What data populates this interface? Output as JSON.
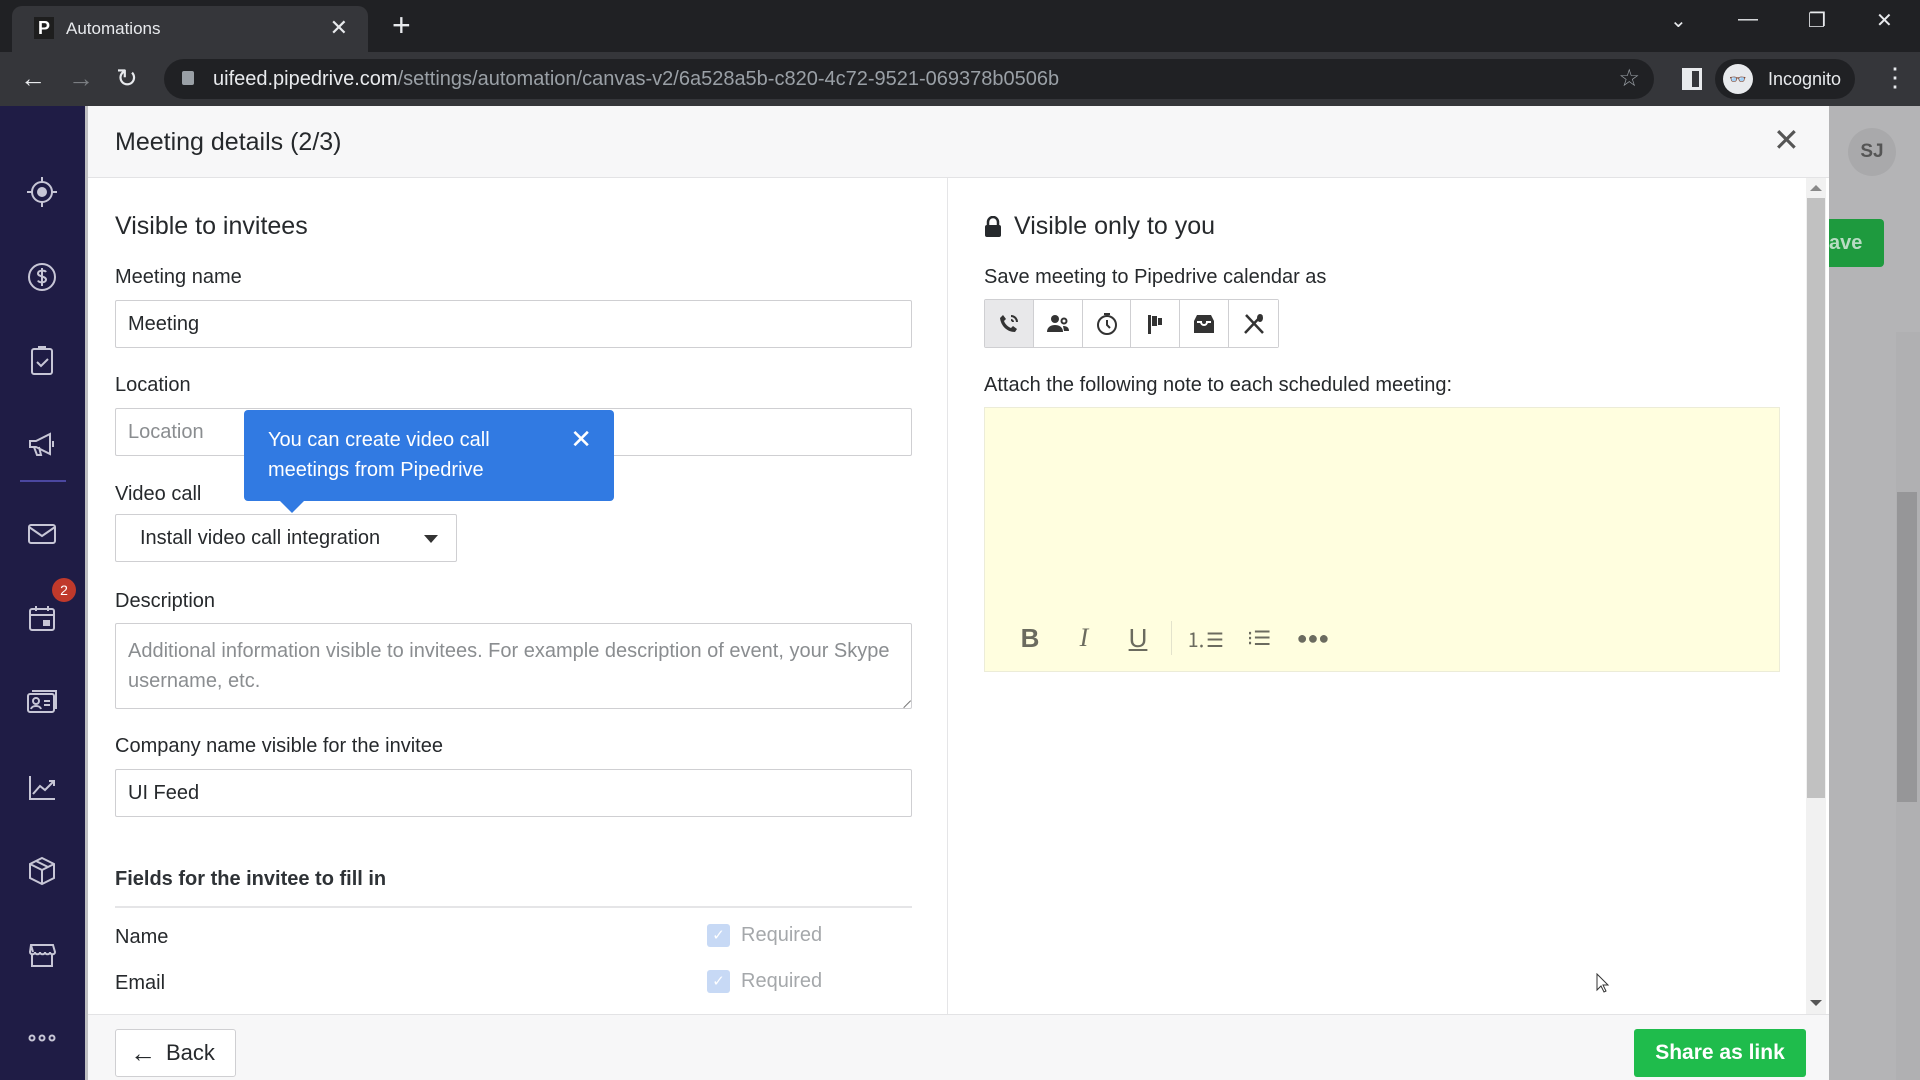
{
  "browser": {
    "tab_title": "Automations",
    "favicon_letter": "P",
    "url_domain": "uifeed.pipedrive.com",
    "url_path": "/settings/automation/canvas-v2/6a528a5b-c820-4c72-9521-069378b0506b",
    "profile_label": "Incognito"
  },
  "sidebar": {
    "items": [
      {
        "name": "leads-icon"
      },
      {
        "name": "deals-icon"
      },
      {
        "name": "activities-icon"
      },
      {
        "name": "campaigns-icon"
      },
      {
        "name": "mail-icon"
      },
      {
        "name": "calendar-icon",
        "badge": "2"
      },
      {
        "name": "contacts-icon"
      },
      {
        "name": "insights-icon"
      },
      {
        "name": "products-icon"
      },
      {
        "name": "marketplace-icon"
      },
      {
        "name": "more-icon"
      }
    ]
  },
  "background": {
    "avatar_initials": "SJ",
    "save_partial": "ave"
  },
  "modal": {
    "title": "Meeting details (2/3)",
    "left": {
      "heading": "Visible to invitees",
      "meeting_name_label": "Meeting name",
      "meeting_name_value": "Meeting",
      "location_label": "Location",
      "location_placeholder": "Location",
      "video_call_label": "Video call",
      "video_call_value": "Install video call integration",
      "tooltip_text": "You can create video call meetings from Pipedrive",
      "description_label": "Description",
      "description_placeholder": "Additional information visible to invitees. For example description of event, your Skype username, etc.",
      "company_label": "Company name visible for the invitee",
      "company_value": "UI Feed",
      "fields_heading": "Fields for the invitee to fill in",
      "fields": [
        {
          "name": "Name",
          "required_label": "Required",
          "checked": true
        },
        {
          "name": "Email",
          "required_label": "Required",
          "checked": true
        }
      ]
    },
    "right": {
      "heading": "Visible only to you",
      "save_as_label": "Save meeting to Pipedrive calendar as",
      "activity_types": [
        "call",
        "meeting",
        "task",
        "deadline",
        "email",
        "lunch"
      ],
      "selected_activity_type": "call",
      "note_label": "Attach the following note to each scheduled meeting:",
      "note_value": ""
    },
    "footer": {
      "back_label": "Back",
      "share_label": "Share as link"
    }
  }
}
